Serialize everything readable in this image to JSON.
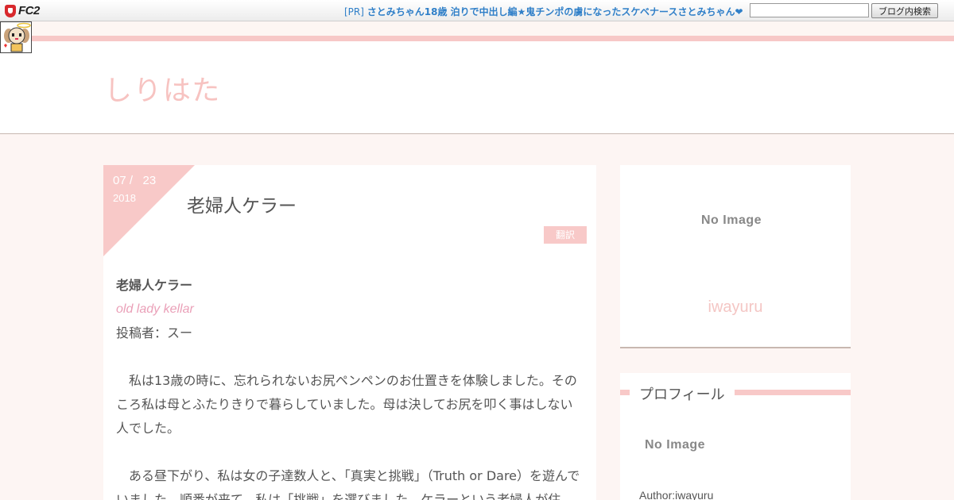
{
  "fc2bar": {
    "logo_text": "FC2",
    "pr_prefix": "[PR]",
    "pr_text": "さとみちゃん18歳 泊りで中出し編★鬼チンポの虜になったスケベナースさとみちゃん❤",
    "search_value": "",
    "search_button": "ブログ内検索"
  },
  "header": {
    "site_title": "しりはた"
  },
  "article": {
    "date_md": "07 /   23",
    "date_year": "2018",
    "title": "老婦人ケラー",
    "category": "翻訳",
    "heading": "老婦人ケラー",
    "english_title": "old lady kellar",
    "poster": "投稿者：スー",
    "para1": "　私は13歳の時に、忘れられないお尻ペンペンのお仕置きを体験しました。そのころ私は母とふたりきりで暮らしていました。母は決してお尻を叩く事はしない人でした。",
    "para2": "　ある昼下がり、私は女の子達数人と、「真実と挑戦」（Truth or Dare）を遊んでいました。順番が来て、私は「挑戦」を選びました。ケラーという老婦人が住"
  },
  "sidebar": {
    "profile_image_text": "No Image",
    "author_name": "iwayuru",
    "profile_heading": "プロフィール",
    "profile_image2_text": "No Image",
    "author_label": "Author:iwayuru"
  },
  "colors": {
    "accent": "#f8c9c8",
    "title": "#f7c3c1",
    "link": "#2f7fc8"
  }
}
